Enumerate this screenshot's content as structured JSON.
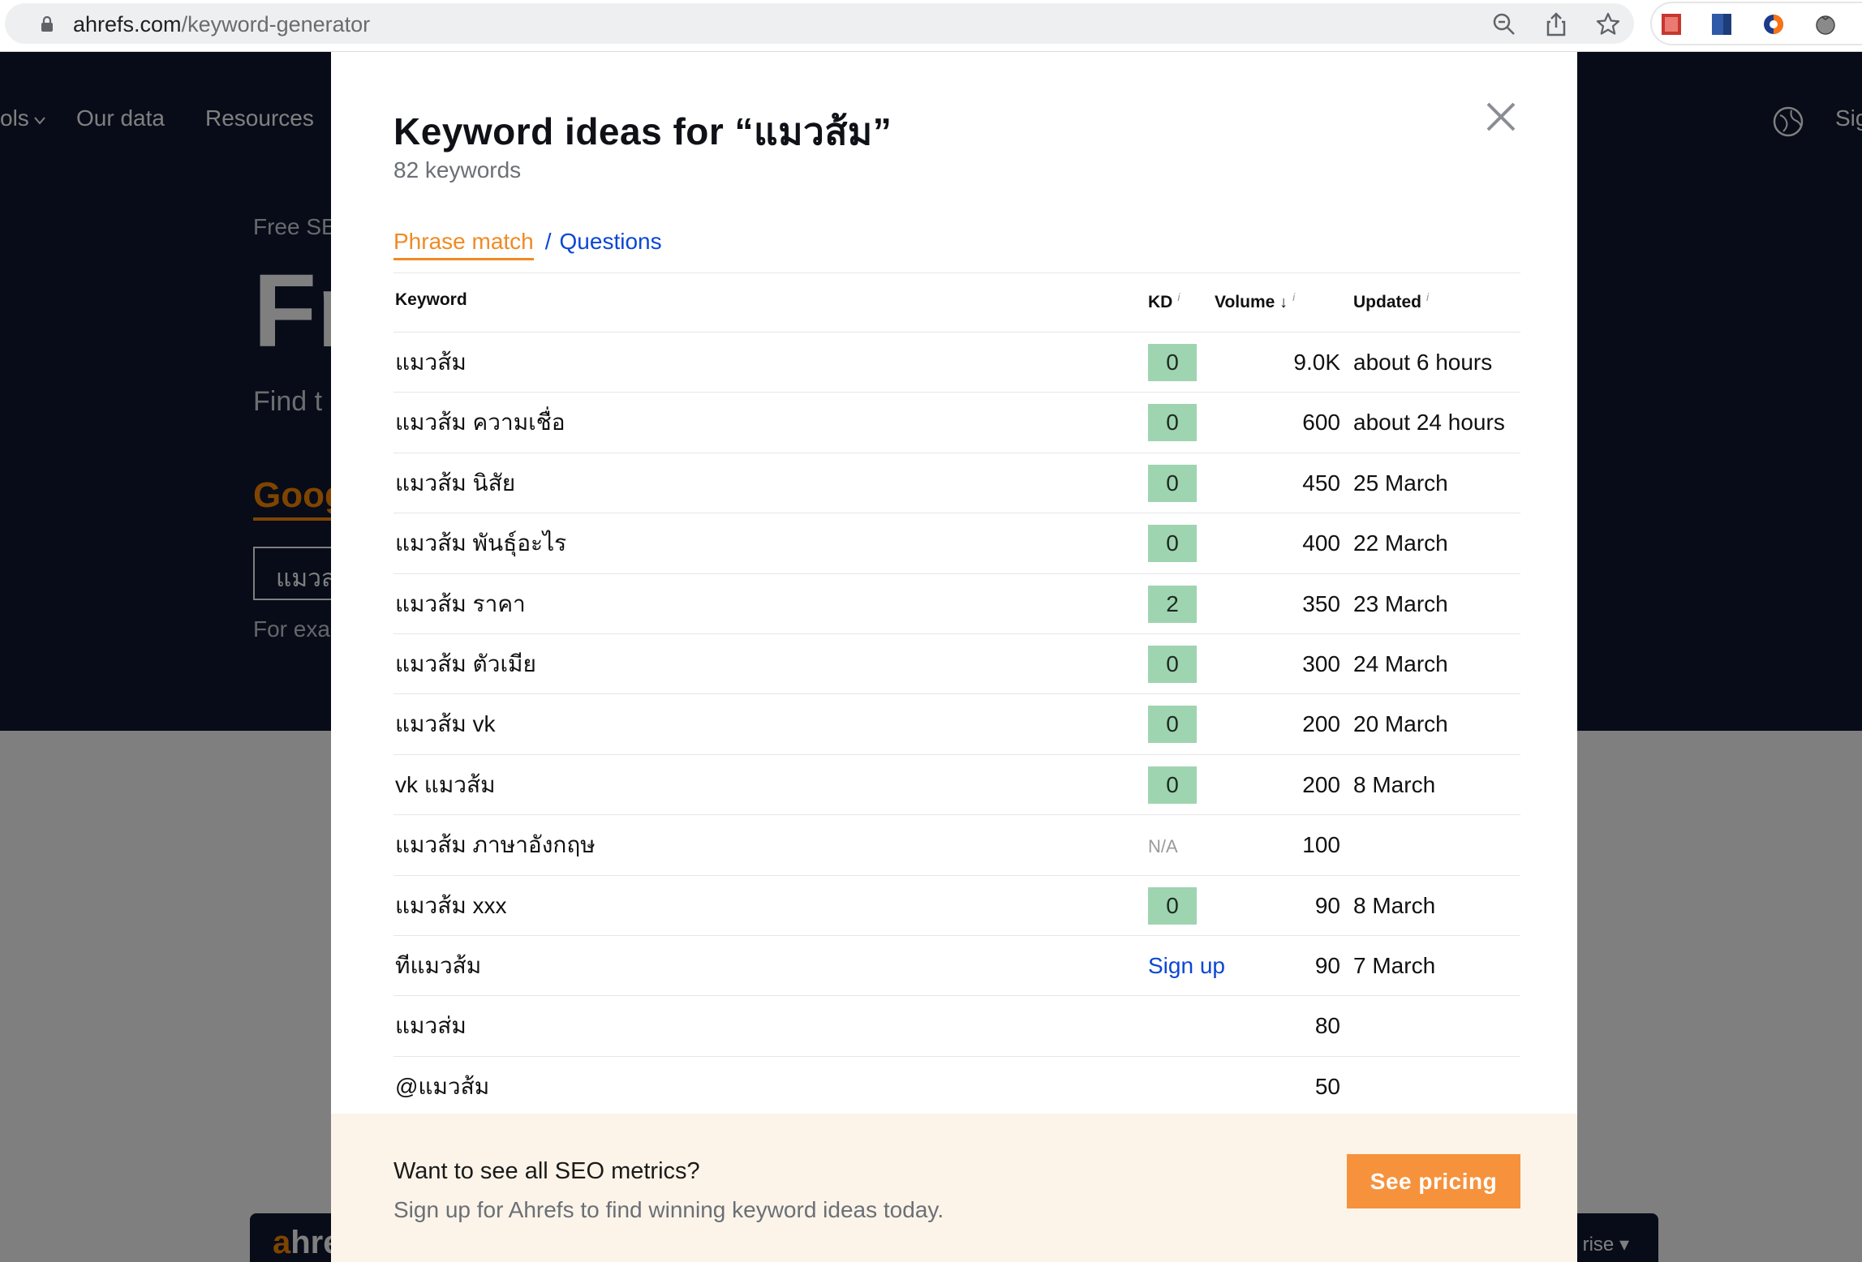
{
  "browser": {
    "url_domain": "ahrefs.com",
    "url_path": "/keyword-generator"
  },
  "background": {
    "nav": [
      "ols",
      "Our data",
      "Resources",
      "Sig"
    ],
    "hero_small": "Free SE",
    "hero_big": "Fr",
    "hero_sub": "Find t",
    "hero_google": "Goog",
    "hero_input_value": "แมวส",
    "hero_example": "For exa",
    "footer_logo_a": "a",
    "footer_logo_rest": "hre",
    "footer_right": "rise"
  },
  "modal": {
    "title": "Keyword ideas for “แมวส้ม”",
    "count": "82 keywords",
    "tabs": {
      "phrase": "Phrase match",
      "separator": "/",
      "questions": "Questions"
    },
    "columns": {
      "keyword": "Keyword",
      "kd": "KD",
      "volume": "Volume",
      "volume_sort_arrow": "↓",
      "updated": "Updated",
      "info": "i"
    },
    "rows": [
      {
        "keyword": "แมวส้ม",
        "kd": "0",
        "kd_type": "badge",
        "volume": "9.0K",
        "updated": "about 6 hours"
      },
      {
        "keyword": "แมวส้ม ความเชื่อ",
        "kd": "0",
        "kd_type": "badge",
        "volume": "600",
        "updated": "about 24 hours"
      },
      {
        "keyword": "แมวส้ม นิสัย",
        "kd": "0",
        "kd_type": "badge",
        "volume": "450",
        "updated": "25 March"
      },
      {
        "keyword": "แมวส้ม พันธุ์อะไร",
        "kd": "0",
        "kd_type": "badge",
        "volume": "400",
        "updated": "22 March"
      },
      {
        "keyword": "แมวส้ม ราคา",
        "kd": "2",
        "kd_type": "badge",
        "volume": "350",
        "updated": "23 March"
      },
      {
        "keyword": "แมวส้ม ตัวเมีย",
        "kd": "0",
        "kd_type": "badge",
        "volume": "300",
        "updated": "24 March"
      },
      {
        "keyword": "แมวส้ม vk",
        "kd": "0",
        "kd_type": "badge",
        "volume": "200",
        "updated": "20 March"
      },
      {
        "keyword": "vk แมวส้ม",
        "kd": "0",
        "kd_type": "badge",
        "volume": "200",
        "updated": "8 March"
      },
      {
        "keyword": "แมวส้ม ภาษาอังกฤษ",
        "kd": "N/A",
        "kd_type": "na",
        "volume": "100",
        "updated": ""
      },
      {
        "keyword": "แมวส้ม xxx",
        "kd": "0",
        "kd_type": "badge",
        "volume": "90",
        "updated": "8 March"
      },
      {
        "keyword": "ทีแมวส้ม",
        "kd": "Sign up",
        "kd_type": "link",
        "volume": "90",
        "updated": "7 March"
      },
      {
        "keyword": "แมวส่ม",
        "kd": "",
        "kd_type": "none",
        "volume": "80",
        "updated": ""
      },
      {
        "keyword": "@แมวส้ม",
        "kd": "",
        "kd_type": "none",
        "volume": "50",
        "updated": ""
      }
    ],
    "promo": {
      "title": "Want to see all SEO metrics?",
      "subtitle": "Sign up for Ahrefs to find winning keyword ideas today.",
      "button": "See pricing"
    }
  },
  "colors": {
    "accent_orange": "#f08a24",
    "link_blue": "#0b47d4",
    "kd_badge_green": "#9fd4b1",
    "promo_bg": "#fcf4e9",
    "button_orange": "#f6923c"
  }
}
